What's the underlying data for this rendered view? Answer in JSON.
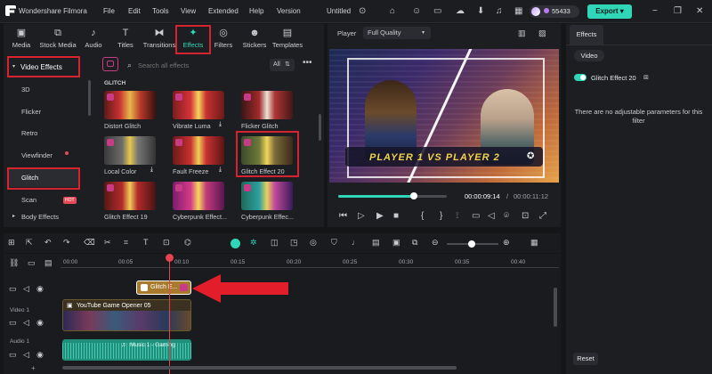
{
  "app": {
    "name": "Wondershare Filmora",
    "menus": [
      "File",
      "Edit",
      "Tools",
      "View",
      "Extended",
      "Help",
      "Version"
    ],
    "project": "Untitled",
    "credits": "55433",
    "export_label": "Export"
  },
  "tabs": [
    {
      "label": "Media",
      "icon": "media-icon"
    },
    {
      "label": "Stock Media",
      "icon": "stock-media-icon"
    },
    {
      "label": "Audio",
      "icon": "audio-icon"
    },
    {
      "label": "Titles",
      "icon": "titles-icon"
    },
    {
      "label": "Transitions",
      "icon": "transitions-icon"
    },
    {
      "label": "Effects",
      "icon": "effects-icon",
      "active": true
    },
    {
      "label": "Filters",
      "icon": "filters-icon"
    },
    {
      "label": "Stickers",
      "icon": "stickers-icon"
    },
    {
      "label": "Templates",
      "icon": "templates-icon"
    }
  ],
  "sidebar": {
    "header": "Video Effects",
    "items": [
      "3D",
      "Flicker",
      "Retro",
      "Viewfinder",
      "Glitch",
      "Scan",
      "Body Effects"
    ],
    "scan_badge": "HOT"
  },
  "search": {
    "placeholder": "Search all effects",
    "filter": "All"
  },
  "section": "GLITCH",
  "effects": [
    "Distort Glitch",
    "Vibrate Luma",
    "Flicker Glitch",
    "Local Color",
    "Fault Freeze",
    "Glitch Effect 20",
    "Glitch Effect 19",
    "Cyberpunk Effect...",
    "Cyberpunk Effec..."
  ],
  "player": {
    "label": "Player",
    "quality": "Full Quality",
    "current_time": "00:00:09:14",
    "total_time": "00:00:11:12",
    "progress": 0.7,
    "overlay_text": "PLAYER 1 VS PLAYER 2"
  },
  "properties": {
    "tab": "Effects",
    "subtab": "Video",
    "effect_name": "Glitch Effect 20",
    "message": "There are no adjustable parameters for this filter",
    "reset": "Reset"
  },
  "timeline": {
    "ruler": [
      "00:00",
      "00:05",
      "00:10",
      "00:15",
      "00:20",
      "00:25",
      "00:30",
      "00:35",
      "00:40",
      "00:45"
    ],
    "effect_clip": "Glitch E...",
    "video_clip": "YouTube Game Opener 05",
    "video_track": "Video 1",
    "audio_track": "Audio 1",
    "audio_clip": "Music 1 - Gaming"
  },
  "colors": {
    "accent": "#2fd7b8",
    "red": "#d62330",
    "playhead": "#e8424f",
    "effect_clip": "#a77a2e",
    "audio_clip": "#1f8e7a"
  }
}
